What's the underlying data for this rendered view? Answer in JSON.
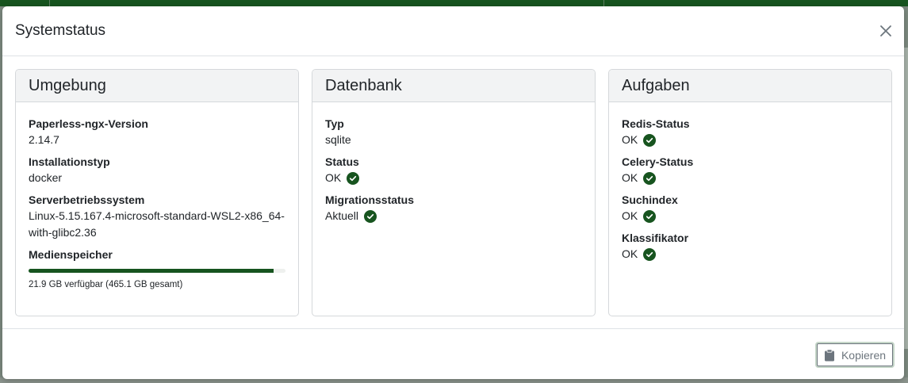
{
  "modal": {
    "title": "Systemstatus",
    "close_icon": "close-icon",
    "copy_label": "Kopieren",
    "copy_icon": "clipboard-icon"
  },
  "environment": {
    "header": "Umgebung",
    "version_label": "Paperless-ngx-Version",
    "version_value": "2.14.7",
    "install_label": "Installationstyp",
    "install_value": "docker",
    "os_label": "Serverbetriebssystem",
    "os_value": "Linux-5.15.167.4-microsoft-standard-WSL2-x86_64-with-glibc2.36",
    "storage_label": "Medienspeicher",
    "storage_used_fraction": 0.953,
    "storage_text": "21.9 GB verfügbar (465.1 GB gesamt)"
  },
  "database": {
    "header": "Datenbank",
    "type_label": "Typ",
    "type_value": "sqlite",
    "status_label": "Status",
    "status_value": "OK",
    "migration_label": "Migrationsstatus",
    "migration_value": "Aktuell"
  },
  "tasks": {
    "header": "Aufgaben",
    "redis_label": "Redis-Status",
    "redis_value": "OK",
    "celery_label": "Celery-Status",
    "celery_value": "OK",
    "index_label": "Suchindex",
    "index_value": "OK",
    "classifier_label": "Klassifikator",
    "classifier_value": "OK"
  },
  "colors": {
    "accent": "#17541f",
    "header_bg": "#f2f3f4",
    "border": "#d5d8db"
  }
}
